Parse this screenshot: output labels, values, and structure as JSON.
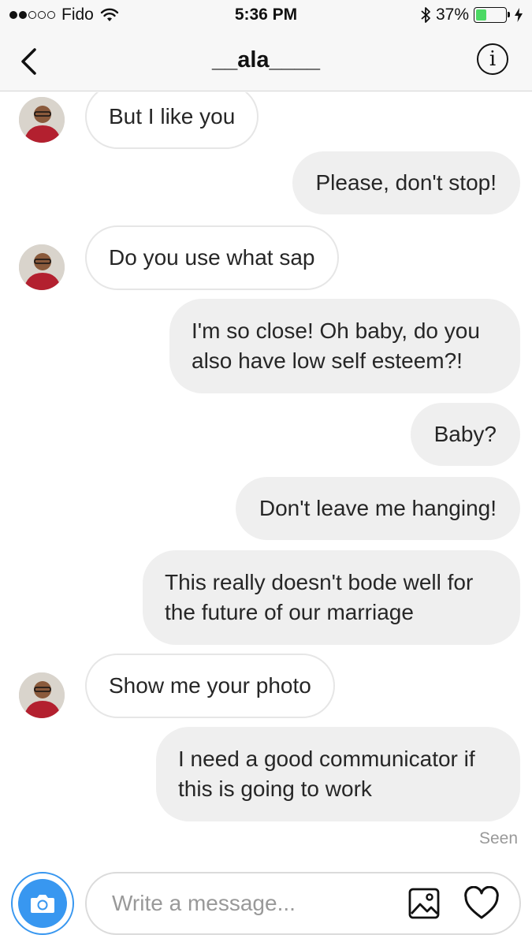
{
  "status_bar": {
    "carrier": "Fido",
    "time": "5:36 PM",
    "battery_percent": "37%",
    "battery_level": 0.37,
    "battery_color": "#4cd964"
  },
  "nav": {
    "title": "__ala____",
    "back_icon": "chevron-left-icon",
    "info_icon": "info-icon"
  },
  "messages": [
    {
      "from": "them",
      "text": "But I like you"
    },
    {
      "from": "me",
      "text": "Please, don't stop!"
    },
    {
      "from": "them",
      "text": "Do you use what sap"
    },
    {
      "from": "me",
      "text": "I'm so close! Oh baby, do you also have low self esteem?!"
    },
    {
      "from": "me",
      "text": "Baby?"
    },
    {
      "from": "me",
      "text": "Don't leave me hanging!"
    },
    {
      "from": "me",
      "text": "This really doesn't bode well for the future of our marriage"
    },
    {
      "from": "them",
      "text": "Show me your photo"
    },
    {
      "from": "me",
      "text": "I need a good communicator if this is going to work"
    }
  ],
  "seen_label": "Seen",
  "composer": {
    "placeholder": "Write a message...",
    "camera_icon": "camera-icon",
    "gallery_icon": "image-icon",
    "like_icon": "heart-icon",
    "accent_color": "#3897f0"
  }
}
